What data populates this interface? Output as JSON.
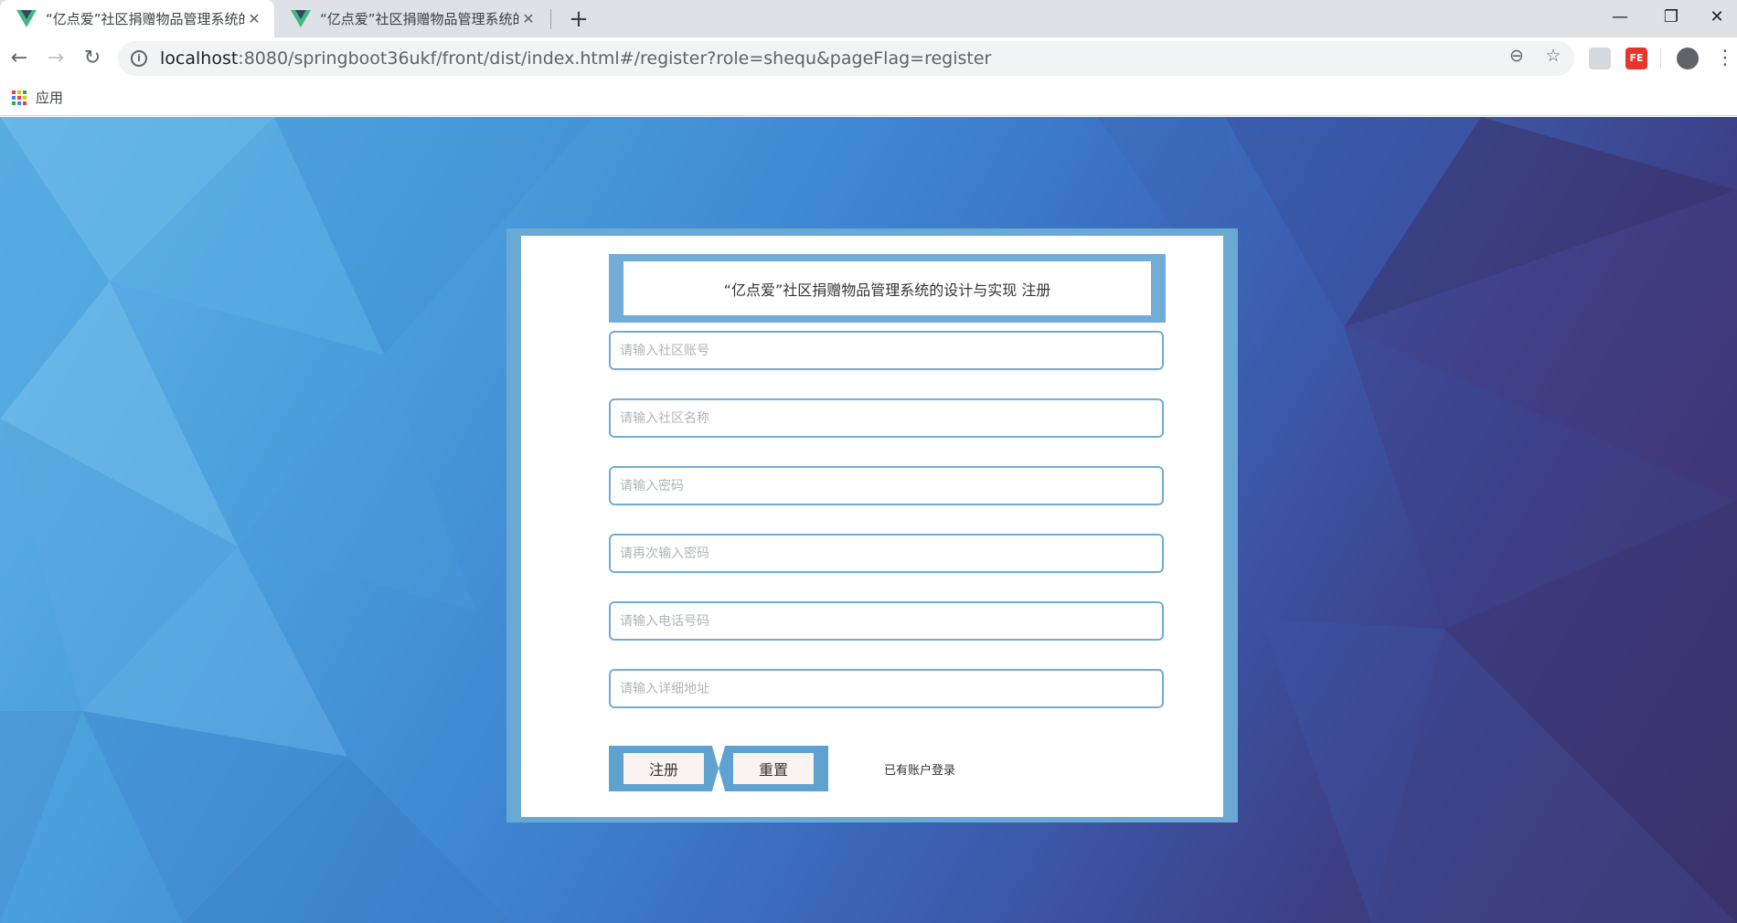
{
  "browser": {
    "tabs": [
      {
        "title": "“亿点爱”社区捐赠物品管理系统的",
        "active": true
      },
      {
        "title": "“亿点爱”社区捐赠物品管理系统的",
        "active": false
      }
    ],
    "url_host": "localhost",
    "url_rest": ":8080/springboot36ukf/front/dist/index.html#/register?role=shequ&pageFlag=register",
    "bookmarks": {
      "apps_label": "应用"
    }
  },
  "register": {
    "title": "“亿点爱”社区捐赠物品管理系统的设计与实现 注册",
    "fields": [
      {
        "placeholder": "请输入社区账号",
        "value": ""
      },
      {
        "placeholder": "请输入社区名称",
        "value": ""
      },
      {
        "placeholder": "请输入密码",
        "value": ""
      },
      {
        "placeholder": "请再次输入密码",
        "value": ""
      },
      {
        "placeholder": "请输入电话号码",
        "value": ""
      },
      {
        "placeholder": "请输入详细地址",
        "value": ""
      }
    ],
    "register_button": "注册",
    "reset_button": "重置",
    "login_link": "已有账户登录"
  },
  "colors": {
    "frame_blue": "#73acd6",
    "background_light": "#62b3e6",
    "background_dark": "#3b2f62",
    "button_face": "#fbf3f0"
  }
}
